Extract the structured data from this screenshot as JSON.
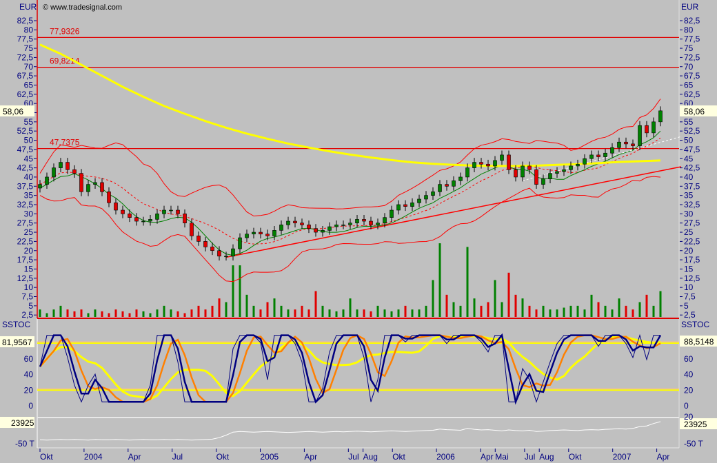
{
  "copyright": "© www.tradesignal.com",
  "chart_data": [
    {
      "type": "candlestick",
      "title": "Price",
      "ylabel": "EUR",
      "ylim": [
        0,
        85
      ],
      "yticks": [
        "2,5",
        "5",
        "7,5",
        "10",
        "12,5",
        "15",
        "17,5",
        "20",
        "22,5",
        "25",
        "27,5",
        "30",
        "32,5",
        "35",
        "37,5",
        "40",
        "42,5",
        "45",
        "47,5",
        "50",
        "52,5",
        "55",
        "57,5",
        "60",
        "62,5",
        "65",
        "67,5",
        "70",
        "72,5",
        "75",
        "77,5",
        "80",
        "82,5"
      ],
      "last_price_label": "58,06",
      "last_price": 58.06,
      "levels": [
        {
          "value": 77.9326,
          "label": "77,9326"
        },
        {
          "value": 69.8214,
          "label": "69,8214"
        },
        {
          "value": 47.7375,
          "label": "47,7375"
        }
      ],
      "interval": "2 weeks, starting 2003-09",
      "close": [
        38,
        40,
        42.5,
        44,
        42,
        41,
        36,
        38,
        38.5,
        36,
        33,
        31,
        30,
        29,
        28,
        28,
        28.5,
        30,
        31,
        31,
        30,
        27.5,
        24,
        22.5,
        21,
        20,
        18.5,
        18.5,
        20.5,
        23.5,
        24.5,
        25,
        24.5,
        24,
        25.5,
        27,
        28,
        27.5,
        27,
        26,
        25,
        25.5,
        26.5,
        27,
        27,
        27.5,
        28.5,
        28,
        27,
        27.5,
        29,
        31,
        32.5,
        32,
        33,
        34,
        35,
        36,
        38,
        37.5,
        39,
        40,
        42.5,
        44,
        43.5,
        43,
        44.5,
        46,
        42,
        40,
        43,
        42,
        38,
        39.5,
        41,
        41.5,
        42,
        43,
        43.5,
        45,
        46,
        45.5,
        46.5,
        48,
        49.5,
        49,
        48.5,
        54,
        52,
        55,
        58
      ],
      "volume": [
        2,
        1,
        2,
        3,
        2,
        1.5,
        2,
        1,
        2,
        1.5,
        1,
        2,
        1.5,
        1,
        2,
        1.5,
        1,
        2,
        3,
        2,
        1.5,
        1,
        2,
        3,
        2,
        3,
        5,
        4,
        14,
        14,
        6,
        3,
        2,
        4,
        5,
        3,
        2,
        2,
        3,
        2,
        7,
        3,
        2,
        1.5,
        2,
        5,
        2,
        2,
        1.5,
        3,
        2,
        1.5,
        2,
        3,
        2,
        2,
        3,
        10,
        20,
        6,
        4,
        3,
        19,
        5,
        3,
        4,
        10,
        4,
        12,
        6,
        5,
        3,
        2,
        3,
        2,
        2,
        2.5,
        3,
        3,
        2,
        6,
        4,
        3,
        2,
        5,
        3,
        2,
        4,
        6,
        3,
        7
      ],
      "moving_average_long": [
        76,
        73.5,
        70.5,
        67.5,
        64.5,
        61.8,
        59.3,
        57.2,
        55.2,
        53.4,
        51.8,
        50.4,
        49.1,
        48,
        47,
        46.1,
        45.3,
        44.6,
        44,
        43.6,
        43.3,
        43.1,
        43,
        43,
        43.1,
        43.3,
        43.5,
        43.8,
        44.1,
        44.3,
        44.5
      ],
      "trendline": {
        "from_index": 27,
        "from_value": 18.2,
        "to_index": 93,
        "to_value": 42.8
      }
    },
    {
      "type": "line",
      "title": "SSTOC",
      "ylim": [
        -20,
        100
      ],
      "yticks": [
        "0",
        "20",
        "40",
        "60",
        "80"
      ],
      "levels": [
        20,
        80
      ],
      "left_value_label": "81,9567",
      "right_value_label": "88,5148"
    },
    {
      "type": "line",
      "title": "Volume indicator",
      "ylabel_top": "23925",
      "ylabel_bottom": "-50 T",
      "right_partial_tick": "20",
      "values": [
        -35,
        -36,
        -35,
        -34,
        -35,
        -34,
        -35,
        -36,
        -34,
        -35,
        -35,
        -34,
        -35,
        -36,
        -35,
        -34,
        -35,
        -35,
        -34,
        -35,
        -34,
        -35,
        -36,
        -35,
        -34,
        -33,
        -28,
        -20,
        -10,
        -8,
        -9,
        -10,
        -9,
        -8,
        -9,
        -10,
        -11,
        -10,
        -9,
        -8,
        -9,
        -10,
        -9,
        -8,
        -9,
        -8,
        -7,
        -8,
        -9,
        -8,
        -7,
        -6,
        -7,
        -8,
        -7,
        -6,
        -5,
        -4,
        0,
        -2,
        -3,
        -4,
        2,
        -1,
        -3,
        -2,
        -4,
        -6,
        -3,
        -5,
        -6,
        -4,
        -8,
        -7,
        -5,
        -4,
        -3,
        -4,
        -5,
        -3,
        -2,
        -3,
        -1,
        0,
        1,
        0,
        2,
        8,
        10,
        18,
        24
      ]
    }
  ],
  "x_axis": {
    "labels": [
      {
        "label": "Okt",
        "month": "2003-10"
      },
      {
        "label": "2004",
        "month": "2004-01"
      },
      {
        "label": "Apr",
        "month": "2004-04"
      },
      {
        "label": "Jul",
        "month": "2004-07"
      },
      {
        "label": "Okt",
        "month": "2004-10"
      },
      {
        "label": "2005",
        "month": "2005-01"
      },
      {
        "label": "Apr",
        "month": "2005-04"
      },
      {
        "label": "Jul",
        "month": "2005-07"
      },
      {
        "label": "Aug",
        "month": "2005-08"
      },
      {
        "label": "Okt",
        "month": "2005-10"
      },
      {
        "label": "2006",
        "month": "2006-01"
      },
      {
        "label": "Apr",
        "month": "2006-04"
      },
      {
        "label": "Mai",
        "month": "2006-05"
      },
      {
        "label": "Jul",
        "month": "2006-07"
      },
      {
        "label": "Aug",
        "month": "2006-08"
      },
      {
        "label": "Okt",
        "month": "2006-10"
      },
      {
        "label": "2007",
        "month": "2007-01"
      },
      {
        "label": "Apr",
        "month": "2007-04"
      }
    ]
  },
  "colors": {
    "background": "#c0c0c0",
    "axis_text": "#000080",
    "up": "#008000",
    "down": "#e00000",
    "ma_long": "#ffff00",
    "band": "#ff0000",
    "stoch_fast": "#000080",
    "stoch_slow": "#ff8000"
  }
}
